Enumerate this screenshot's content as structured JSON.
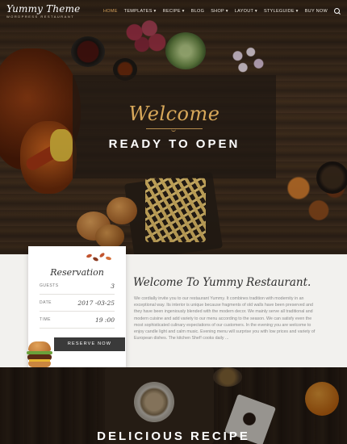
{
  "brand": {
    "name": "Yummy Theme",
    "tagline": "WORDPRESS RESTAURANT"
  },
  "nav": {
    "items": [
      {
        "label": "HOME",
        "active": true
      },
      {
        "label": "TEMPLATES ▾",
        "active": false
      },
      {
        "label": "RECIPE ▾",
        "active": false
      },
      {
        "label": "BLOG",
        "active": false
      },
      {
        "label": "SHOP ▾",
        "active": false
      },
      {
        "label": "LAYOUT ▾",
        "active": false
      },
      {
        "label": "STYLEGUIDE ▾",
        "active": false
      },
      {
        "label": "BUY NOW",
        "active": false
      }
    ],
    "search_icon": "search-icon"
  },
  "hero": {
    "script": "Welcome",
    "title": "READY TO OPEN"
  },
  "reservation": {
    "title": "Reservation",
    "fields": [
      {
        "label": "GUESTS",
        "value": "3"
      },
      {
        "label": "DATE",
        "value": "2017 -03-25"
      },
      {
        "label": "TIME",
        "value": "19 :00"
      }
    ],
    "button": "RESERVE NOW"
  },
  "intro": {
    "heading": "Welcome To Yummy Restaurant.",
    "text": "We cordially invite you to our restaurant Yummy. It combines tradition with modernity in an exceptional way. Its interior is unique because fragments of old walls have been preserved and they have been ingeniously blended with the modern decor. We mainly serve all traditional and modern cuisine and add variety to our menu according to the season. We can satisfy even the most sophisticated culinary expectations of our customers. In the evening you are welcome to enjoy candle light and calm music. Evening menu will surprise you with low prices and variety of European dishes. The kitchen Shef! cooks daily ..."
  },
  "bottom": {
    "title": "DELICIOUS RECIPE"
  },
  "colors": {
    "accent": "#d6a15b",
    "button": "#3a3a3a",
    "section_bg": "#f2f1ee"
  }
}
